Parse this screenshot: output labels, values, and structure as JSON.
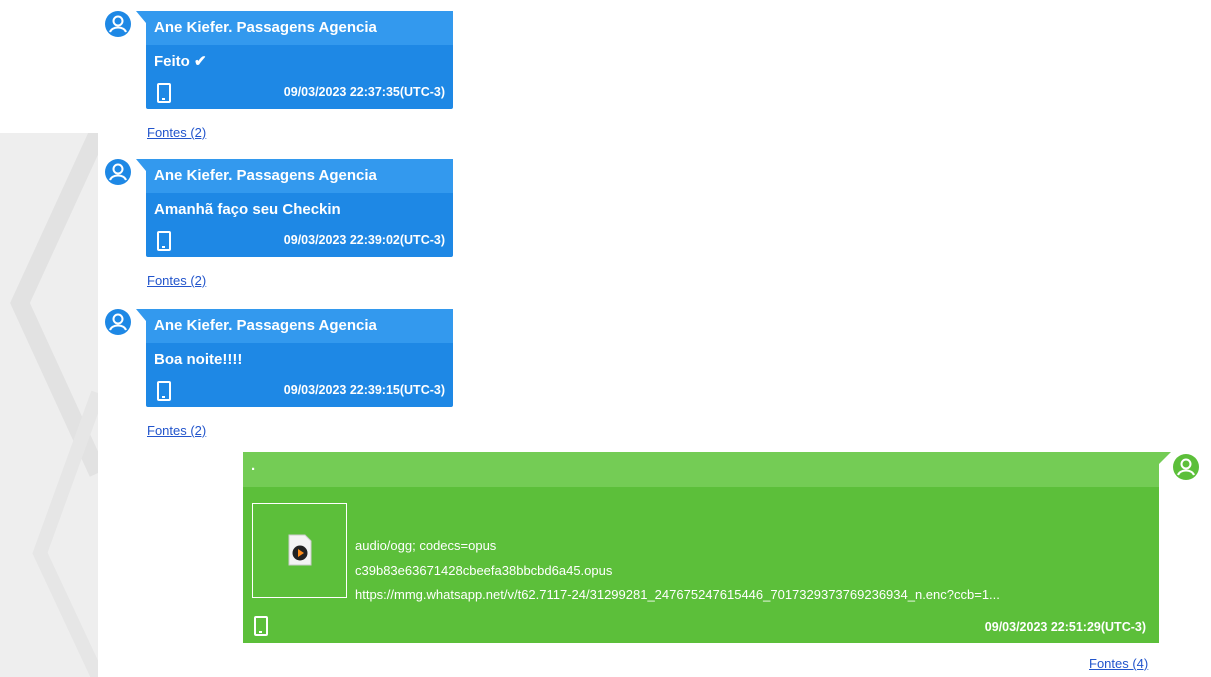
{
  "colors": {
    "incoming_bubble": "#1e88e5",
    "incoming_header": "#3399ee",
    "outgoing_bubble": "#5cbf3a",
    "outgoing_header": "#74cc55",
    "avatar_incoming": "#1e88e5",
    "avatar_outgoing": "#5cbf3a",
    "link": "#2255cc"
  },
  "messages": [
    {
      "sender": "Ane Kiefer. Passagens Agencia",
      "text": "Feito ✔",
      "timestamp": "09/03/2023 22:37:35(UTC-3)",
      "sources": "Fontes (2)"
    },
    {
      "sender": "Ane Kiefer. Passagens Agencia",
      "text": "Amanhã faço seu Checkin",
      "timestamp": "09/03/2023 22:39:02(UTC-3)",
      "sources": "Fontes (2)"
    },
    {
      "sender": "Ane Kiefer. Passagens Agencia",
      "text": "Boa noite!!!!",
      "timestamp": "09/03/2023 22:39:15(UTC-3)",
      "sources": "Fontes (2)"
    }
  ],
  "outgoing": {
    "header": ".",
    "attachment": {
      "mime": "audio/ogg; codecs=opus",
      "filename": "c39b83e63671428cbeefa38bbcbd6a45.opus",
      "url": "https://mmg.whatsapp.net/v/t62.7117-24/31299281_247675247615446_7017329373769236934_n.enc?ccb=1..."
    },
    "timestamp": "09/03/2023 22:51:29(UTC-3)",
    "sources": "Fontes (4)"
  }
}
